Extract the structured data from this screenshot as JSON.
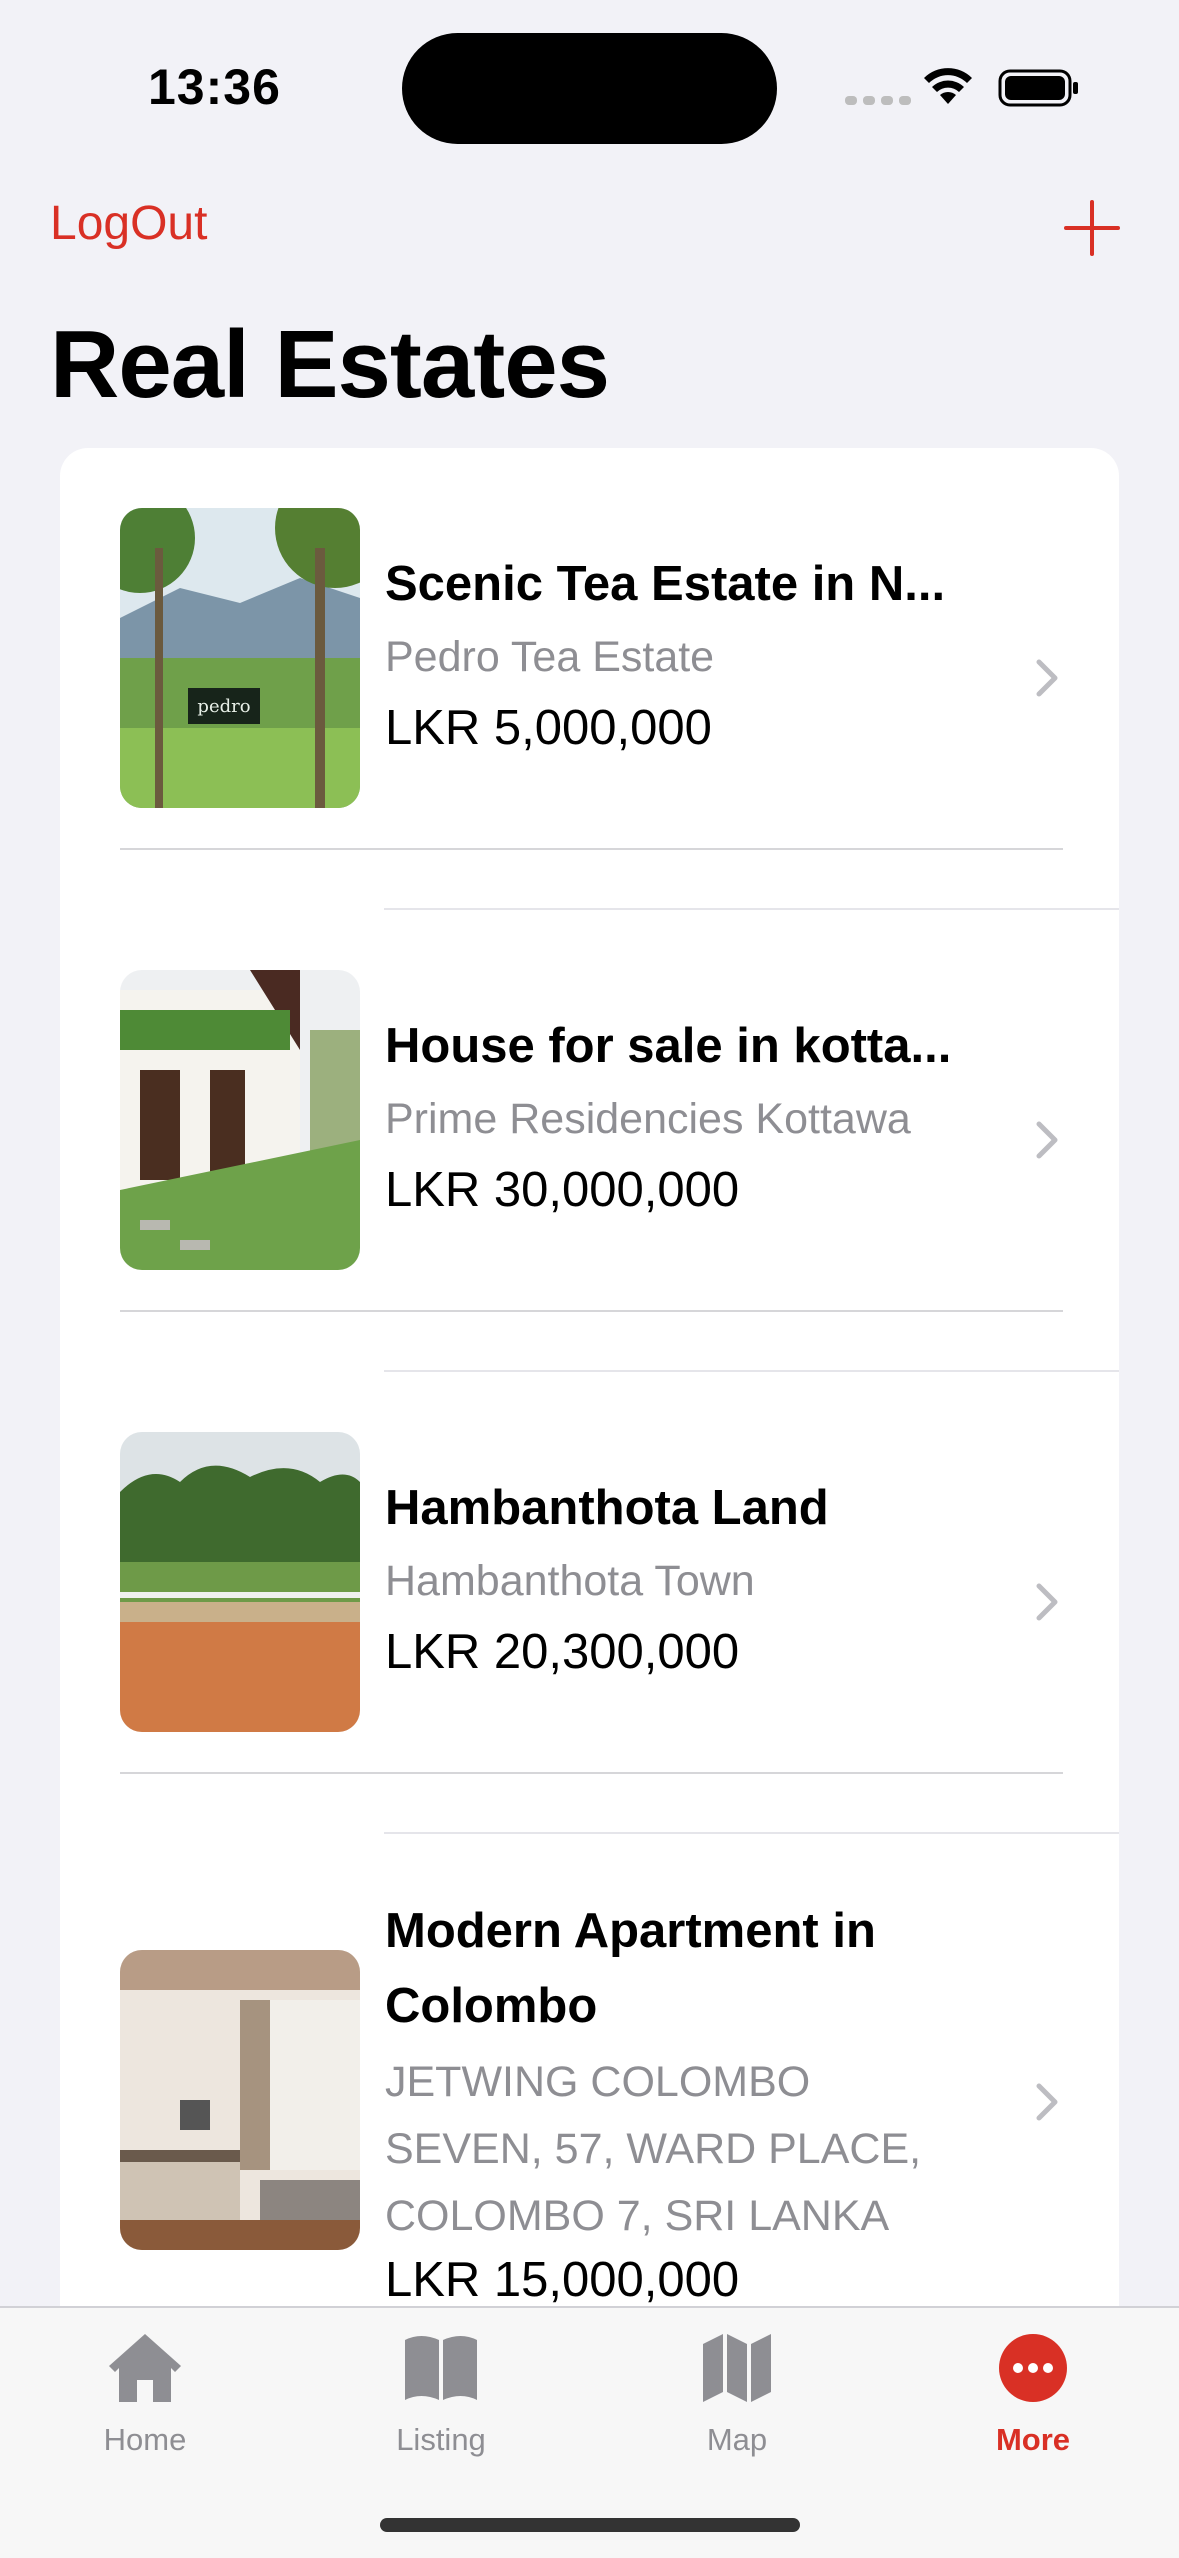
{
  "status_bar": {
    "time": "13:36"
  },
  "nav": {
    "logout_label": "LogOut",
    "add_icon": "plus-icon",
    "accent_color": "#D93025"
  },
  "page": {
    "title": "Real Estates"
  },
  "listings": [
    {
      "title": "Scenic Tea Estate in N...",
      "location": "Pedro Tea Estate",
      "price": "LKR 5,000,000"
    },
    {
      "title": "House for sale in kotta...",
      "location": "Prime Residencies Kottawa",
      "price": "LKR 30,000,000"
    },
    {
      "title": "Hambanthota Land",
      "location": "Hambanthota Town",
      "price": "LKR 20,300,000"
    },
    {
      "title": "Modern Apartment in Colombo",
      "location": "JETWING COLOMBO SEVEN, 57, WARD PLACE, COLOMBO 7, SRI LANKA",
      "price": "LKR 15,000,000"
    }
  ],
  "tab_bar": {
    "tabs": [
      {
        "label": "Home",
        "icon": "house-icon"
      },
      {
        "label": "Listing",
        "icon": "book-icon"
      },
      {
        "label": "Map",
        "icon": "map-icon"
      },
      {
        "label": "More",
        "icon": "more-icon"
      }
    ],
    "active_tab": "More"
  }
}
